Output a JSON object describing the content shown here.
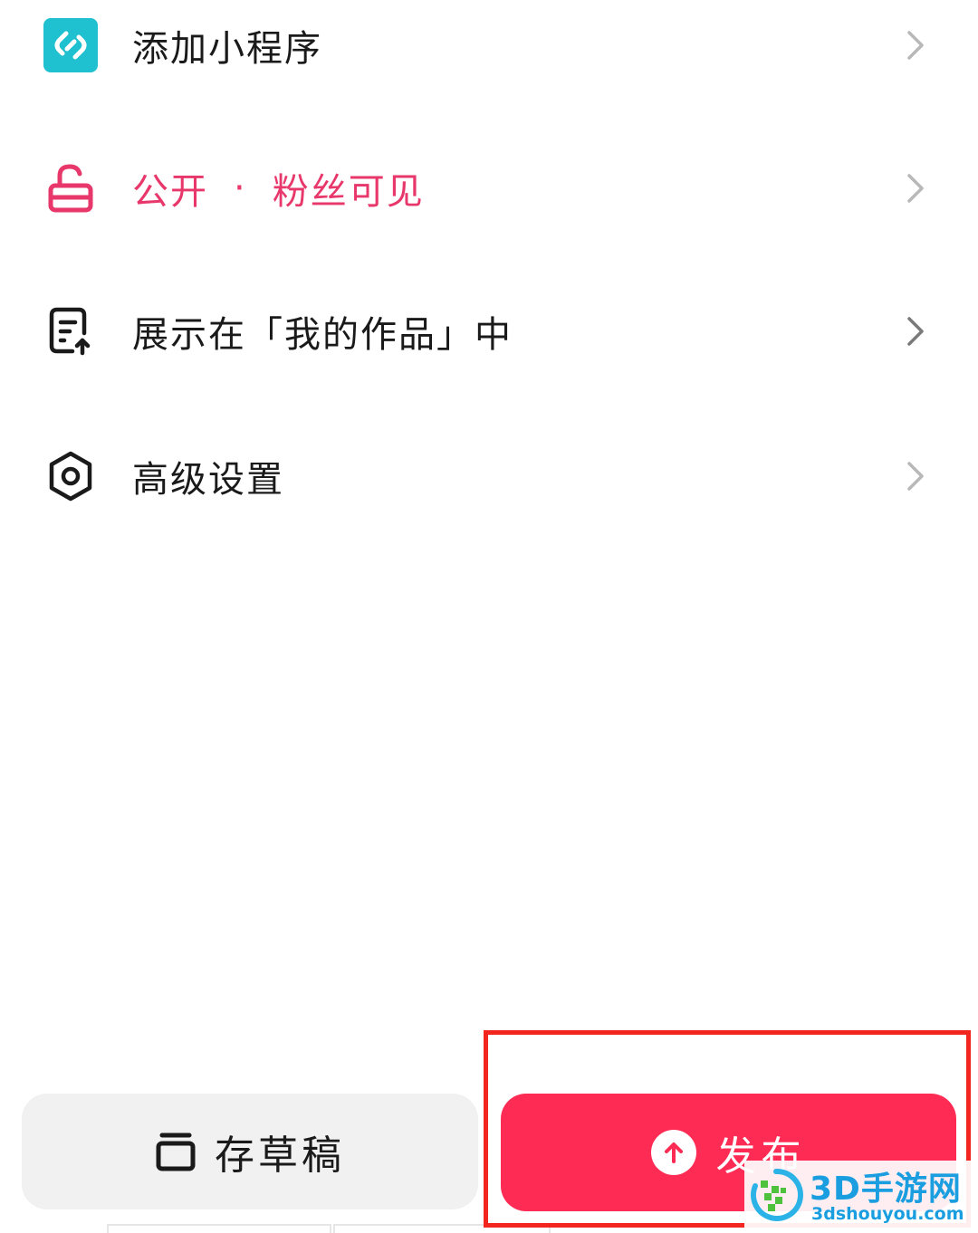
{
  "settings": {
    "items": [
      {
        "icon": "mini-program-icon",
        "label": "添加小程序"
      },
      {
        "icon": "unlock-icon",
        "label_primary": "公开",
        "separator": "·",
        "label_secondary": "粉丝可见"
      },
      {
        "icon": "works-display-icon",
        "label": "展示在「我的作品」中"
      },
      {
        "icon": "advanced-settings-icon",
        "label": "高级设置"
      }
    ]
  },
  "bottom_bar": {
    "draft_label": "存草稿",
    "publish_label": "发布"
  },
  "colors": {
    "accent": "#fe2c55",
    "visibility_text": "#e8376a",
    "mini_program_bg": "#1fc0cf",
    "text_primary": "#1a1a1a",
    "chevron": "#b8b8b8",
    "highlight_box": "#f2261f"
  },
  "watermark": {
    "title": "3D手游网",
    "subtitle": "3dshouyou.com"
  }
}
